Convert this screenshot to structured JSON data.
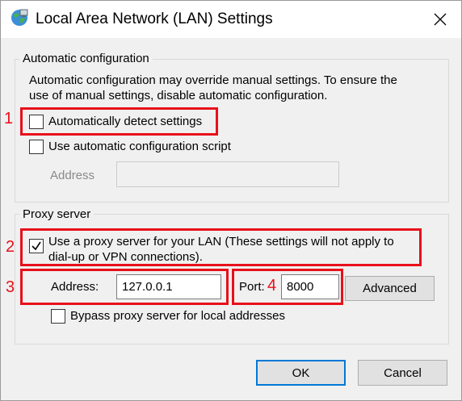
{
  "window": {
    "title": "Local Area Network (LAN) Settings",
    "icon": "globe-network-icon"
  },
  "auto_config": {
    "group_label": "Automatic configuration",
    "description_line1": "Automatic configuration may override manual settings.  To ensure the",
    "description_line2": "use of manual settings, disable automatic configuration.",
    "detect_label": "Automatically detect settings",
    "detect_checked": false,
    "script_label": "Use automatic configuration script",
    "script_checked": false,
    "address_label": "Address",
    "address_value": ""
  },
  "proxy": {
    "group_label": "Proxy server",
    "use_proxy_line1": "Use a proxy server for your LAN (These settings will not apply to",
    "use_proxy_line2": "dial-up or VPN connections).",
    "use_proxy_checked": true,
    "address_label": "Address:",
    "address_value": "127.0.0.1",
    "port_label": "Port:",
    "port_value": "8000",
    "advanced_label": "Advanced",
    "bypass_label": "Bypass proxy server for local addresses",
    "bypass_checked": false
  },
  "buttons": {
    "ok": "OK",
    "cancel": "Cancel"
  },
  "annotations": {
    "colors": {
      "highlight": "#e8101a"
    },
    "labels": [
      "1",
      "2",
      "3",
      "4"
    ]
  }
}
